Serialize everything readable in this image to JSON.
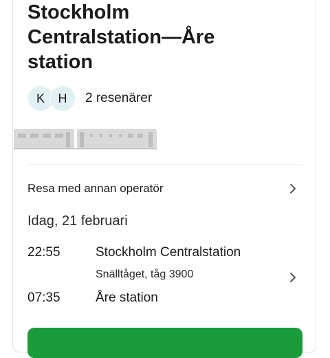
{
  "trip": {
    "title": "Stockholm Centralstation—Åre station"
  },
  "travelers": {
    "initials": [
      "K",
      "H"
    ],
    "count_label": "2 resenärer"
  },
  "operator_row": {
    "label": "Resa med annan operatör"
  },
  "journey": {
    "date_label": "Idag, 21 februari",
    "departure_time": "22:55",
    "departure_station": "Stockholm Centralstation",
    "train_info": "Snälltåget, tåg 3900",
    "arrival_time": "07:35",
    "arrival_station": "Åre station"
  },
  "colors": {
    "accent_green": "#1b9c3b",
    "avatar_bg": "#e1f0f2",
    "divider": "#e3e3e3"
  }
}
